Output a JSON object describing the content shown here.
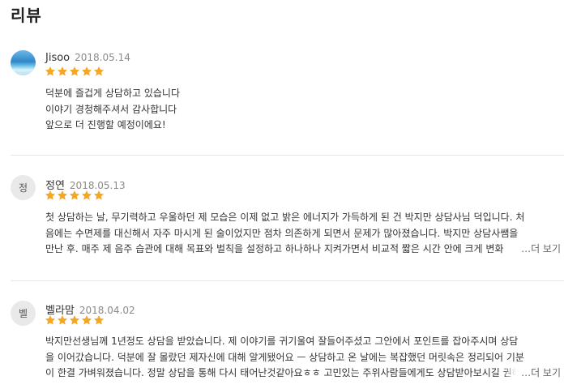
{
  "section_title": "리뷰",
  "colors": {
    "star": "#f5a623",
    "divider": "#e6e6e6"
  },
  "reviews": [
    {
      "avatar": {
        "type": "photo",
        "initial": ""
      },
      "name": "Jisoo",
      "date": "2018.05.14",
      "rating": 5,
      "lines": [
        "덕분에 즐겁게 상담하고 있습니다",
        "이야기 경청해주셔서 감사합니다",
        "앞으로 더 진행할 예정이에요!"
      ],
      "more_label": ""
    },
    {
      "avatar": {
        "type": "initial",
        "initial": "정"
      },
      "name": "정연",
      "date": "2018.05.13",
      "rating": 5,
      "lines": [
        "첫 상담하는 날, 무기력하고 우울하던 제 모습은 이제 없고 밝은 에너지가 가득하게 된 건 박지만 상담사님 덕입니다. 처",
        "음에는 수면제를 대신해서 자주 마시게 된 술이었지만 점차 의존하게 되면서 문제가 많아졌습니다. 박지만 상담사쌤을",
        "만난 후. 매주 제 음주 습관에 대해 목표와 벌칙을 설정하고 하나하나 지켜가면서 비교적 짧은 시간 안에 크게 변화"
      ],
      "more_label": "…더 보기"
    },
    {
      "avatar": {
        "type": "initial",
        "initial": "벨"
      },
      "name": "벨라맘",
      "date": "2018.04.02",
      "rating": 5,
      "lines": [
        "박지만선생님께 1년정도 상담을 받았습니다. 제 이야기를 귀기울여 잘들어주셨고 그안에서 포인트를 잡아주시며 상담",
        "을 이어갔습니다. 덕분에 잘 몰랐던 제자신에 대해 알게됐어요 ㅡ 상담하고 온 날에는 복잡했던 머릿속은 정리되어 기분",
        "이 한결 가벼워졌습니다. 정말 상담을 통해 다시 태어난것같아요ㅎㅎ 고민있는 주위사람들에게도 상담받아보시길 권해요"
      ],
      "more_label": "…더 보기"
    }
  ]
}
